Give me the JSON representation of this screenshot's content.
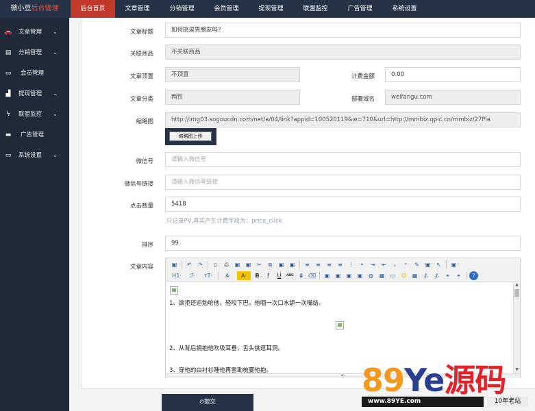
{
  "brand": {
    "name": "微小豆",
    "suffix": "后台管理"
  },
  "topnav": [
    "后台首页",
    "文章管理",
    "分销管理",
    "会员管理",
    "提现管理",
    "联盟监控",
    "广告管理",
    "系统设置"
  ],
  "sidebar": [
    {
      "icon": "car-icon",
      "glyph": "🚗",
      "label": "文章管理",
      "chevron": "⌄"
    },
    {
      "icon": "document-icon",
      "glyph": "▤",
      "label": "分销管理",
      "chevron": "⌄"
    },
    {
      "icon": "card-icon",
      "glyph": "▭",
      "label": "会员管理",
      "chevron": ""
    },
    {
      "icon": "bar-chart-icon",
      "glyph": "▟",
      "label": "提现管理",
      "chevron": "⌄"
    },
    {
      "icon": "bolt-icon",
      "glyph": "ϟ",
      "label": "联盟监控",
      "chevron": "⌄"
    },
    {
      "icon": "briefcase-icon",
      "glyph": "▬",
      "label": "广告管理",
      "chevron": ""
    },
    {
      "icon": "laptop-icon",
      "glyph": "▭",
      "label": "系统设置",
      "chevron": "⌄"
    }
  ],
  "form": {
    "title_label": "文章标题",
    "title_value": "如何挑逗男朋友吗？",
    "product_label": "关联商品",
    "product_value": "不关联商品",
    "pin_label": "文章顶置",
    "pin_value": "不顶置",
    "amount_label": "计费金额",
    "amount_value": "0.00",
    "category_label": "文章分类",
    "category_value": "两性",
    "domain_label": "部署域名",
    "domain_value": "weifangu.com",
    "thumb_label": "缩略图",
    "thumb_value": "http://img03.sogoucdn.com/net/a/04/link?appid=100520119&w=710&url=http://mmbiz.qpic.cn/mmbiz/27Pla",
    "upload_label": "缩略图上传",
    "wechat_label": "微信号",
    "wechat_placeholder": "请输入微信号",
    "wechat_link_label": "微信号链接",
    "wechat_link_placeholder": "请输入微信号链接",
    "clicks_label": "点击数量",
    "clicks_value": "5418",
    "clicks_hint": "只记录PV,真实产生计费字段为：price_click",
    "sort_label": "排序",
    "sort_value": "99",
    "content_label": "文章内容"
  },
  "editor": {
    "toolbar_row1": [
      "▣",
      "↶",
      "↷",
      "▯",
      "⎙",
      "▣",
      "▣",
      "✂",
      "⧉",
      "▣",
      "▣",
      "≡",
      "≡",
      "≡",
      "≡",
      "⋮",
      "•",
      "⇥",
      "⇤",
      "ₓ",
      "ˣ",
      "✎",
      "▣",
      "↖",
      "▣"
    ],
    "toolbar_row2": [
      "H1·",
      "ℱ·",
      "тT·",
      "A·",
      "A·",
      "B",
      "I",
      "U",
      "ABC",
      "⋕",
      "⌫",
      "▣",
      "▣",
      "▣",
      "▣",
      "◍",
      "▦",
      "▭",
      "☺",
      "▦",
      "⚓",
      "⚓",
      "⚭",
      "⚭",
      "?"
    ],
    "para1": "1、欲拒还迎勉呛他，轻咬下巴，他咽一次口水舔一次嘴结。",
    "para2": "2、从背后拥抱他吹吸耳垂，舌头挑逗耳洞。",
    "para3": "3、穿他的白衬衫睡他再雷勘梳要他抱。",
    "resize": "✢"
  },
  "submit_label": "⊙提交",
  "watermark": {
    "num": "89",
    "ye": "Ye",
    "cn": "源码",
    "url": "www.89YE.com",
    "tag": "10年老站"
  },
  "colors": {
    "nav_bg": "#263346",
    "active_tab": "#c0392b",
    "sidebar_bg": "#1f2937"
  }
}
